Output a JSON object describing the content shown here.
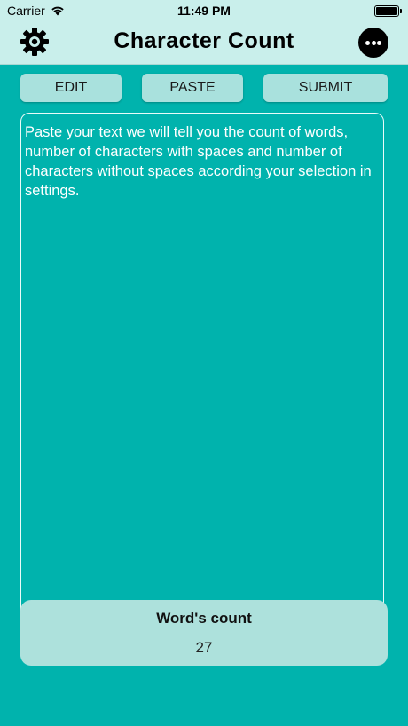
{
  "status_bar": {
    "carrier": "Carrier",
    "time": "11:49 PM"
  },
  "nav": {
    "title": "Character Count",
    "settings_icon": "gear-icon",
    "more_icon": "ellipsis-circle-icon"
  },
  "toolbar": {
    "edit_label": "EDIT",
    "paste_label": "PASTE",
    "submit_label": "SUBMIT"
  },
  "text_area": {
    "value": "Paste your text we will tell you the count of words, number of characters with spaces and number of characters without spaces according your selection in settings."
  },
  "count_panel": {
    "label": "Word's count",
    "value": "27"
  },
  "colors": {
    "background": "#00b3ad",
    "header": "#c9efeb",
    "button": "#a9e1dd",
    "panel": "#ade1dc",
    "text": "#ffffff"
  }
}
